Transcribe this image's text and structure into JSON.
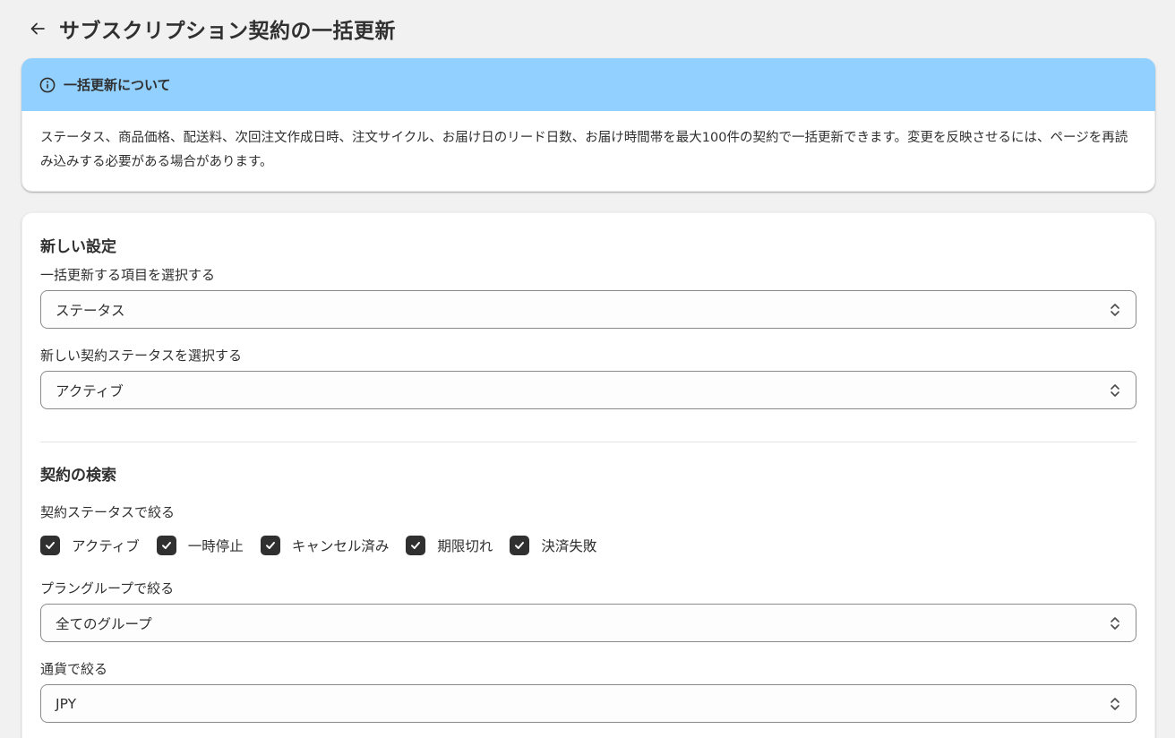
{
  "header": {
    "title": "サブスクリプション契約の一括更新"
  },
  "info": {
    "title": "一括更新について",
    "body": "ステータス、商品価格、配送料、次回注文作成日時、注文サイクル、お届け日のリード日数、お届け時間帯を最大100件の契約で一括更新できます。変更を反映させるには、ページを再読み込みする必要がある場合があります。"
  },
  "new_settings": {
    "title": "新しい設定",
    "item_label": "一括更新する項目を選択する",
    "item_value": "ステータス",
    "status_label": "新しい契約ステータスを選択する",
    "status_value": "アクティブ"
  },
  "search": {
    "title": "契約の検索",
    "status_filter_label": "契約ステータスで絞る",
    "statuses": [
      {
        "label": "アクティブ",
        "checked": true
      },
      {
        "label": "一時停止",
        "checked": true
      },
      {
        "label": "キャンセル済み",
        "checked": true
      },
      {
        "label": "期限切れ",
        "checked": true
      },
      {
        "label": "決済失敗",
        "checked": true
      }
    ],
    "plan_group_label": "プラングループで絞る",
    "plan_group_value": "全てのグループ",
    "currency_label": "通貨で絞る",
    "currency_value": "JPY"
  },
  "colors": {
    "banner": "#91d0ff",
    "checkbox": "#303030",
    "background": "#f1f1f1"
  }
}
